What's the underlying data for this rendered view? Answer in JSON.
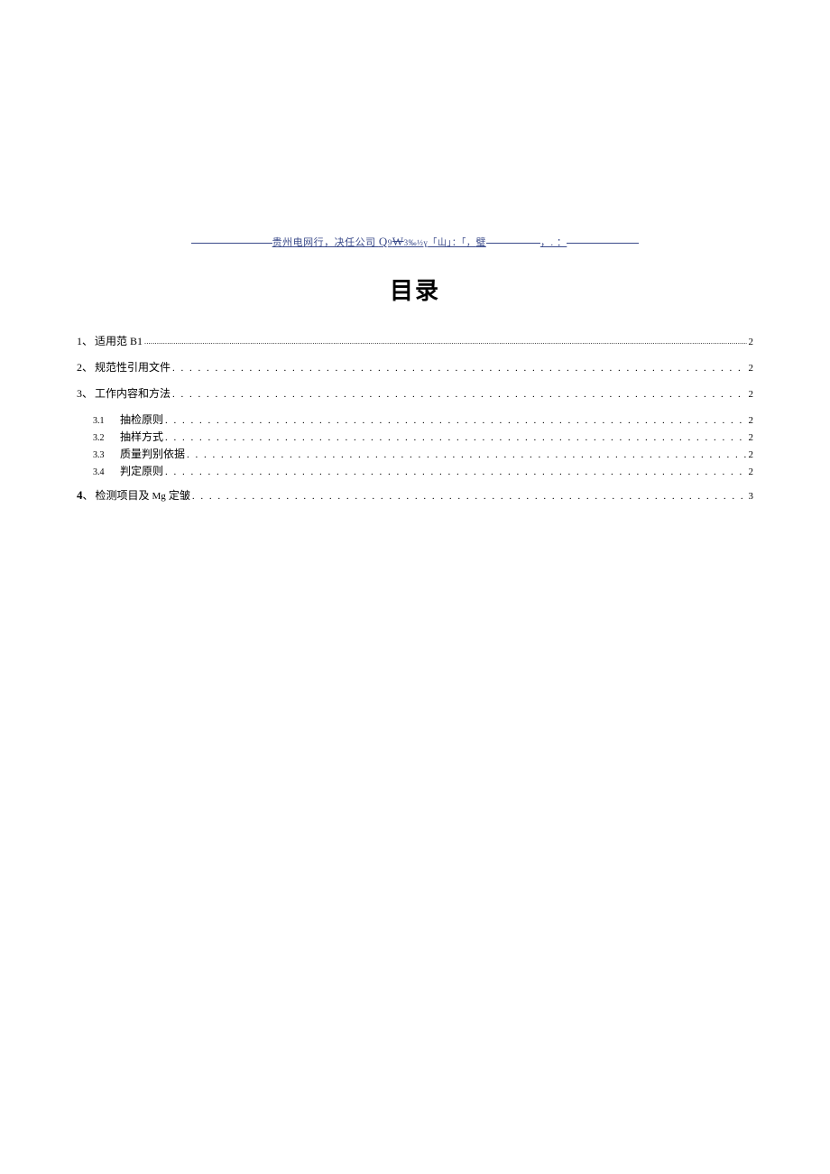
{
  "header": {
    "text_a": "贵州电网行，决任公司 ",
    "q": "Q",
    "nine": "9",
    "w": "W",
    "sub": "3‰½ɣ",
    "bracket": "「山」：「，",
    "bi": "璧",
    "tail": "，. ："
  },
  "title": "目录",
  "toc": [
    {
      "num": "1、",
      "label": "适用范 B1",
      "page": "2",
      "leader_style": "fine"
    },
    {
      "num": "2、",
      "label": "规范性引用文件 ",
      "page": "2",
      "leader_style": "dots"
    },
    {
      "num": "3、",
      "label": "工作内容和方法 ",
      "page": "2",
      "leader_style": "dots"
    }
  ],
  "subs": [
    {
      "num": "3.1",
      "label": "抽检原则 ",
      "page": "2"
    },
    {
      "num": "3.2",
      "label": "抽样方式 ",
      "page": "2"
    },
    {
      "num": "3.3",
      "label": "质量判别依据 ",
      "page": "2"
    },
    {
      "num": "3.4",
      "label": "判定原则 ",
      "page": "2"
    }
  ],
  "toc4": {
    "num": "4",
    "sep": "、",
    "label_a": "检测项目及 ",
    "mg": "Mg",
    "label_b": " 定皱 ",
    "page": "3"
  }
}
